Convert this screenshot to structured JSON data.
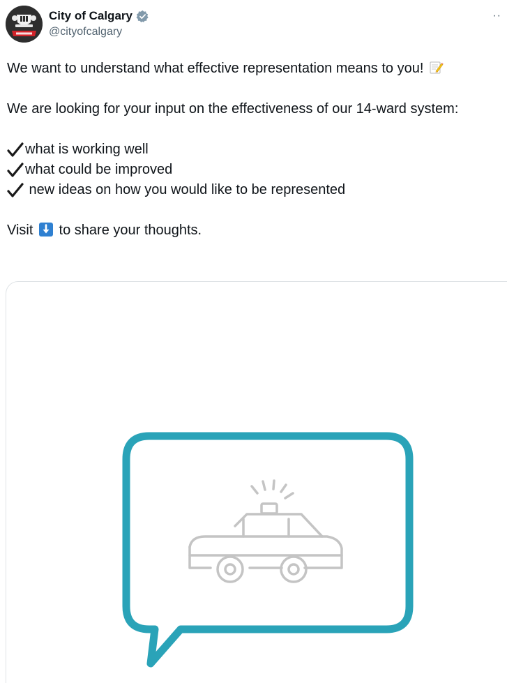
{
  "author": {
    "display_name": "City of Calgary",
    "handle": "@cityofcalgary",
    "avatar_icon": "city-crest-icon",
    "verified": true,
    "verified_icon": "verified-badge-icon"
  },
  "menu": {
    "more_label": "··",
    "more_icon": "more-options-icon"
  },
  "tweet": {
    "line1": "We want to understand what effective representation means to you!",
    "line1_emoji": "memo-emoji-icon",
    "line2": "We are looking for your input on the effectiveness of our 14-ward system:",
    "checklist": [
      {
        "icon": "checkmark-icon",
        "text": "what is working well"
      },
      {
        "icon": "checkmark-icon",
        "text": "what could be improved"
      },
      {
        "icon": "checkmark-icon",
        "text": " new ideas on how you would like to be represented"
      }
    ],
    "cta_prefix": "Visit",
    "cta_emoji": "down-arrow-emoji-icon",
    "cta_suffix": "to share your thoughts."
  },
  "card": {
    "graphic_icons": [
      "speech-bubble-icon",
      "police-car-icon"
    ],
    "colors": {
      "bubble": "#2aa3b8",
      "car": "#c4c4c4"
    }
  },
  "colors": {
    "text": "#0f1419",
    "secondary": "#536471",
    "verified_badge": "#829aab",
    "emoji_blue": "#2f80d1"
  }
}
